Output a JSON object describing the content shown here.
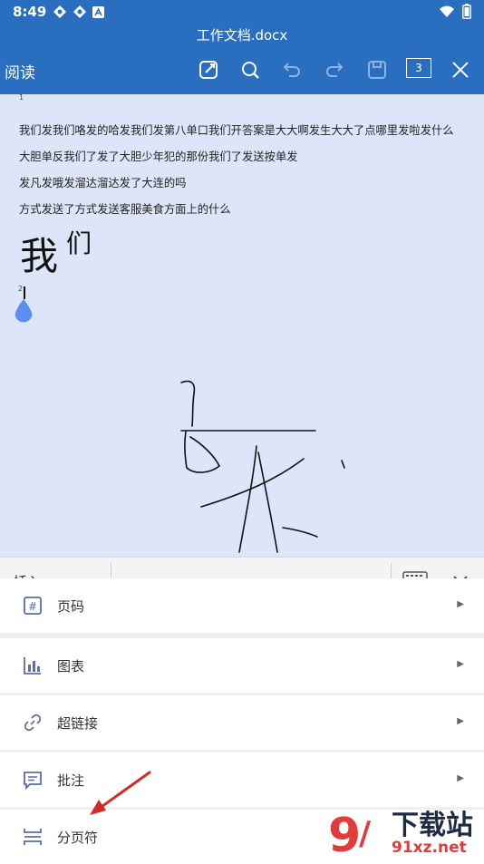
{
  "status": {
    "time": "8:49"
  },
  "title_bar": {
    "filename": "工作文档.docx"
  },
  "toolbar": {
    "read_label": "阅读",
    "page_count": "3"
  },
  "document": {
    "page_marker_1": "1",
    "paragraphs": [
      "我们发我们咯发的哈发我们发第八单口我们开答案是大大啊发生大大了点哪里发啦发什么",
      "大胆单反我们了发了大胆少年犯的那份我们了发送按单发",
      "发凡发哦发溜达溜达发了大连的吗",
      "方式发送了方式发送客服美食方面上的什么"
    ],
    "big_text_1": "我",
    "big_text_2": "们",
    "page_marker_2": "2"
  },
  "insert_bar": {
    "label": "插入"
  },
  "menu": {
    "items": [
      {
        "label": "页码",
        "icon": "page-number-icon"
      },
      {
        "label": "图表",
        "icon": "chart-icon"
      },
      {
        "label": "超链接",
        "icon": "hyperlink-icon"
      },
      {
        "label": "批注",
        "icon": "comment-icon"
      },
      {
        "label": "分页符",
        "icon": "page-break-icon"
      }
    ]
  },
  "watermark": {
    "text": "下载站",
    "url_text": "91xz.net"
  },
  "colors": {
    "header_bg": "#2a6ebf",
    "doc_bg": "#dde6f8",
    "accent_drop": "#5a8ef0",
    "arrow": "#d62a2a"
  }
}
